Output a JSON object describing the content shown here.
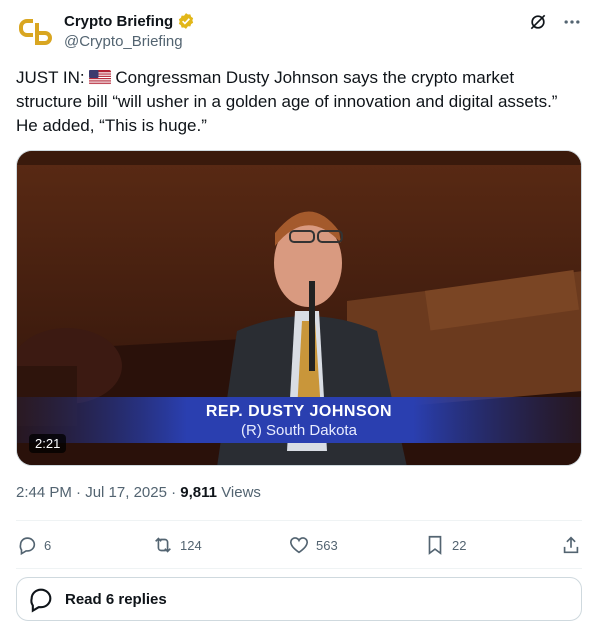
{
  "author": {
    "name": "Crypto Briefing",
    "handle": "@Crypto_Briefing",
    "avatar_icon": "crypto-briefing-logo",
    "verified_color": "#e2b719"
  },
  "post": {
    "text_prefix": "JUST IN: ",
    "flag_icon": "us-flag-icon",
    "text_body": "Congressman Dusty Johnson says the crypto market structure bill “will usher in a golden age of innovation and digital assets.” He added, “This is huge.”",
    "video": {
      "duration": "2:21",
      "caption_name": "REP. DUSTY JOHNSON",
      "caption_subtitle": "(R) South Dakota"
    },
    "meta": {
      "time": "2:44 PM",
      "separator": "·",
      "date": "Jul 17, 2025",
      "views_count": "9,811",
      "views_label": "Views"
    }
  },
  "actions": {
    "replies": "6",
    "reposts": "124",
    "likes": "563",
    "bookmarks": "22"
  },
  "read_replies_label": "Read 6 replies"
}
